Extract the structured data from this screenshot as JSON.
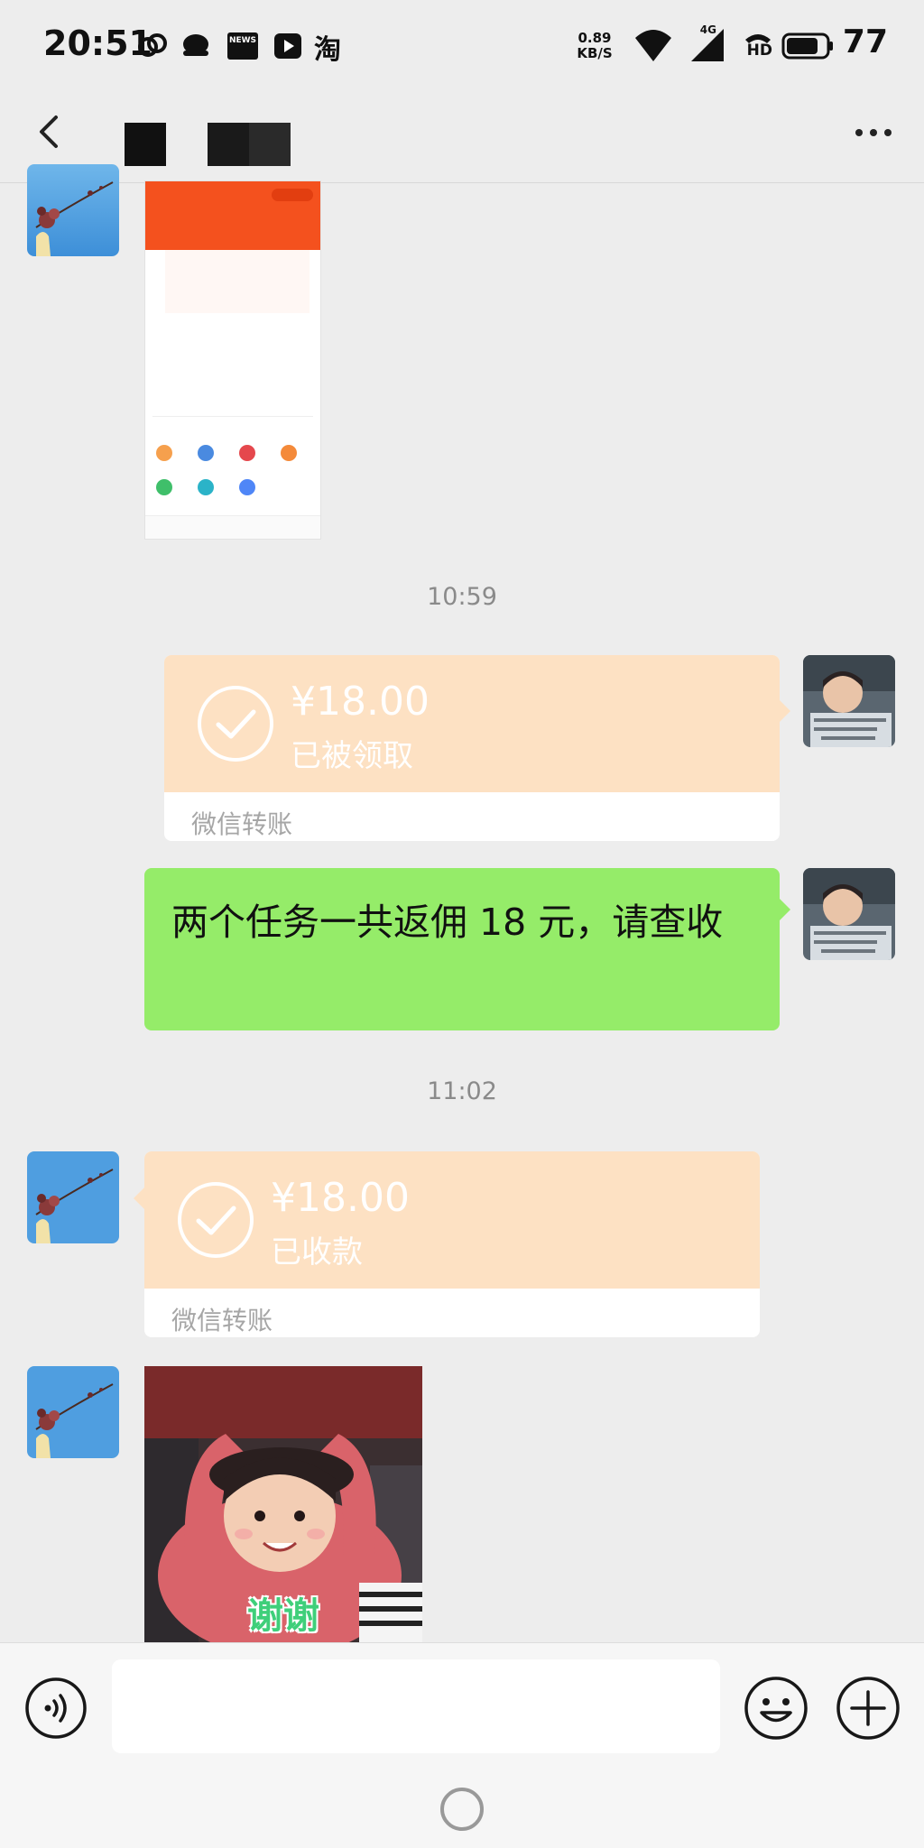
{
  "status_bar": {
    "time": "20:51",
    "net_speed_value": "0.89",
    "net_speed_unit": "KB/S",
    "network": "4G",
    "hd": "HD",
    "battery": "77",
    "app_glyph": "淘",
    "news_glyph": "NEWS"
  },
  "header": {
    "back_icon": "chevron-left-icon",
    "more_icon": "more-dots-icon"
  },
  "messages": {
    "time_1": "10:59",
    "transfer_1": {
      "amount": "¥18.00",
      "status": "已被领取",
      "footer": "微信转账"
    },
    "text_1": "两个任务一共返佣 18 元，请查收",
    "time_2": "11:02",
    "transfer_2": {
      "amount": "¥18.00",
      "status": "已收款",
      "footer": "微信转账"
    },
    "sticker_caption": "谢谢"
  },
  "input_bar": {
    "placeholder": "",
    "voice_icon": "voice-icon",
    "emoji_icon": "emoji-icon",
    "plus_icon": "plus-icon"
  },
  "colors": {
    "background": "#ededed",
    "transfer_orange": "#fde1c3",
    "self_bubble_green": "#95ec69",
    "timestamp_gray": "#8a8a8a"
  }
}
